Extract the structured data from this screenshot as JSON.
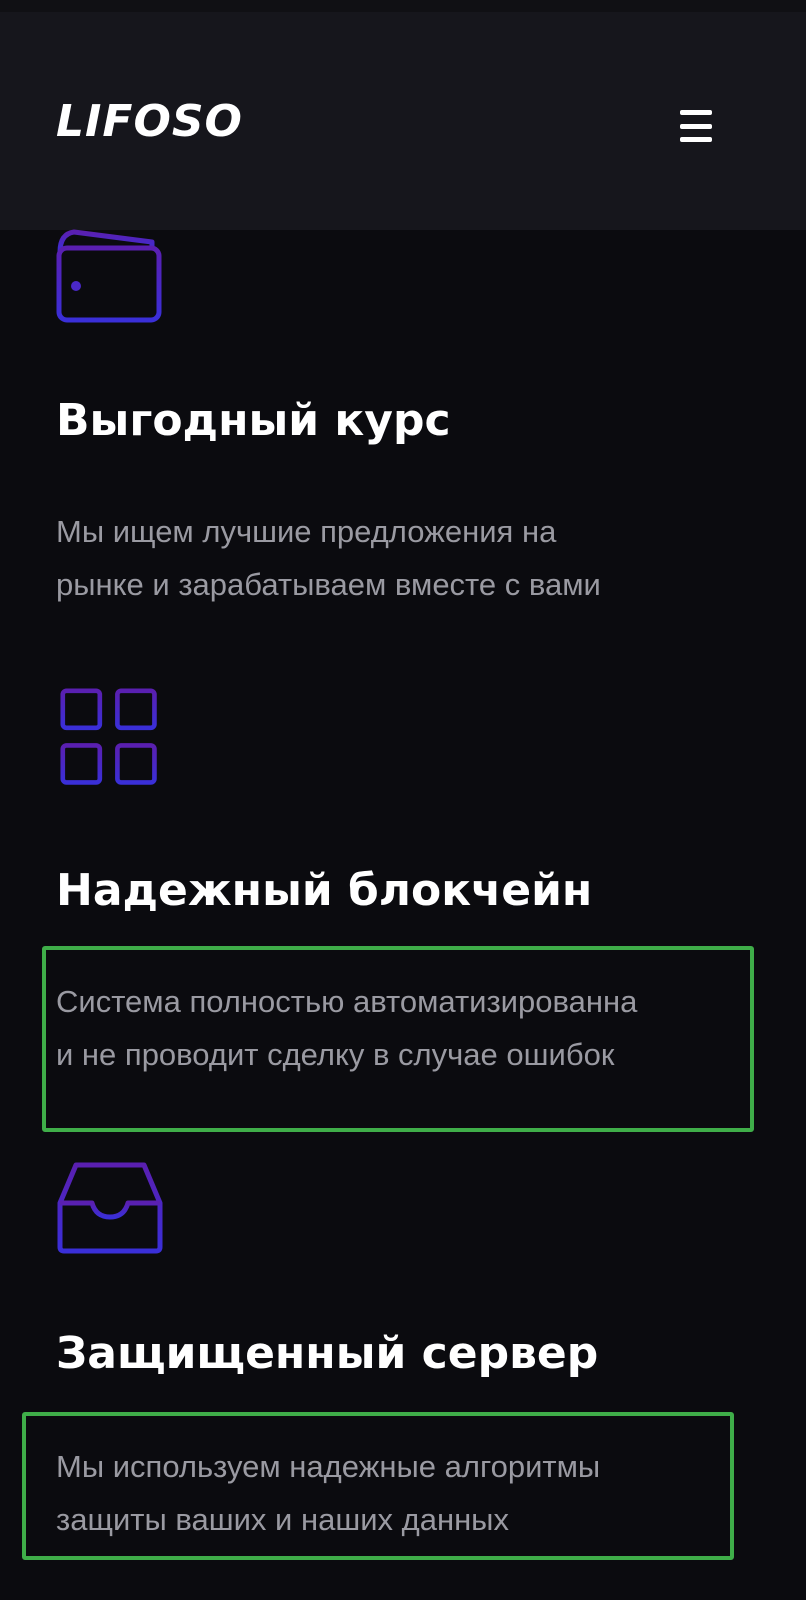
{
  "header": {
    "logo": "LIFOSO",
    "menu_icon": "hamburger-menu-icon"
  },
  "features": [
    {
      "icon": "wallet-icon",
      "title": "Выгодный курс",
      "description_lines": [
        "Мы ищем лучшие предложения на",
        "рынке и зарабатываем вместе с вами"
      ]
    },
    {
      "icon": "grid-icon",
      "title": "Надежный блокчейн",
      "description_lines": [
        "Система полностью автоматизированна",
        "и не проводит сделку в случае ошибок"
      ]
    },
    {
      "icon": "inbox-tray-icon",
      "title": "Защищенный сервер",
      "description_lines": [
        "Мы используем надежные алгоритмы",
        "защиты ваших и наших данных"
      ]
    }
  ],
  "colors": {
    "background": "#0b0b0f",
    "header_background": "#16161c",
    "icon_gradient_start": "#5a1fb0",
    "icon_gradient_end": "#3a2fd8",
    "title": "#ffffff",
    "description": "#9a9aa2",
    "highlight_border": "#3fae49"
  }
}
